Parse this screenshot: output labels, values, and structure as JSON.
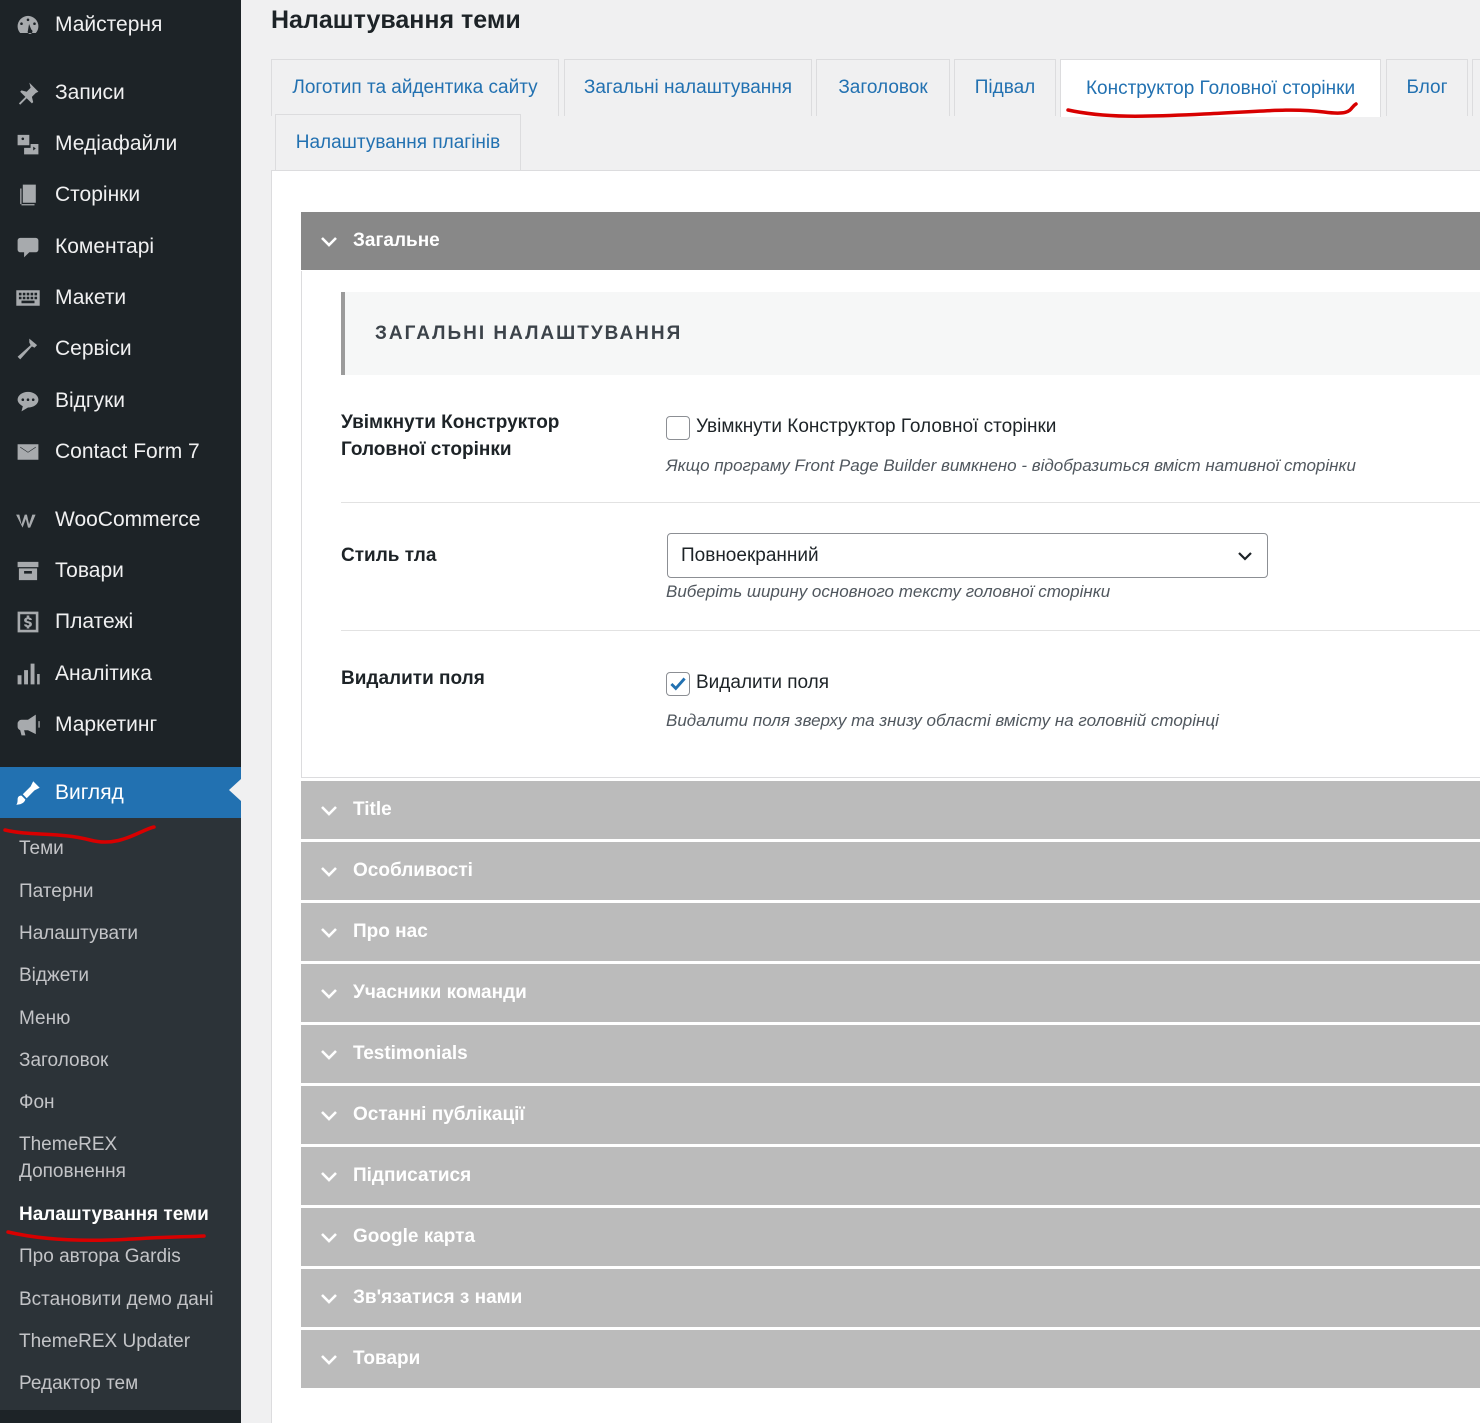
{
  "sidebar": {
    "items": [
      {
        "label": "Майстерня",
        "icon": "dashboard-icon"
      },
      {
        "label": "Записи",
        "icon": "pin-icon"
      },
      {
        "label": "Медіафайли",
        "icon": "media-icon"
      },
      {
        "label": "Сторінки",
        "icon": "pages-icon"
      },
      {
        "label": "Коментарі",
        "icon": "comment-icon"
      },
      {
        "label": "Макети",
        "icon": "layouts-icon"
      },
      {
        "label": "Сервіси",
        "icon": "hammer-icon"
      },
      {
        "label": "Відгуки",
        "icon": "feedback-icon"
      },
      {
        "label": "Contact Form 7",
        "icon": "mail-icon"
      },
      {
        "label": "WooCommerce",
        "icon": "woo-icon"
      },
      {
        "label": "Товари",
        "icon": "archive-icon"
      },
      {
        "label": "Платежі",
        "icon": "dollar-icon"
      },
      {
        "label": "Аналітика",
        "icon": "chart-icon"
      },
      {
        "label": "Маркетинг",
        "icon": "megaphone-icon"
      },
      {
        "label": "Вигляд",
        "icon": "brush-icon"
      }
    ],
    "submenu": [
      "Теми",
      "Патерни",
      "Налаштувати",
      "Віджети",
      "Меню",
      "Заголовок",
      "Фон",
      "ThemeREX Доповнення",
      "Налаштування теми",
      "Про автора Gardis",
      "Встановити демо дані",
      "ThemeREX Updater",
      "Редактор тем"
    ],
    "active_color": "#2271b1"
  },
  "page": {
    "title": "Налаштування теми"
  },
  "tabs": [
    "Логотип та айдентика сайту",
    "Загальні налаштування",
    "Заголовок",
    "Підвал",
    "Конструктор Головної сторінки",
    "Блог",
    "Налаштування плагінів"
  ],
  "active_tab": "Конструктор Головної сторінки",
  "accordion": {
    "open_section": "Загальне",
    "section_title": "ЗАГАЛЬНІ НАЛАШТУВАННЯ",
    "rows": {
      "enable_builder": {
        "label": "Увімкнути Конструктор Головної сторінки",
        "checkbox_label": "Увімкнути Конструктор Головної сторінки",
        "checked": false,
        "description": "Якщо програму Front Page Builder вимкнено - відобразиться вміст нативної сторінки"
      },
      "background_style": {
        "label": "Стиль тла",
        "selected": "Повноекранний",
        "description": "Виберіть ширину основного тексту головної сторінки"
      },
      "remove_margins": {
        "label": "Видалити поля",
        "checkbox_label": "Видалити поля",
        "checked": true,
        "description": "Видалити поля зверху та знизу області вмісту на головній сторінці"
      }
    },
    "collapsed_sections": [
      "Title",
      "Особливості",
      "Про нас",
      "Учасники команди",
      "Testimonials",
      "Останні публікації",
      "Підписатися",
      "Google карта",
      "Зв'язатися з нами",
      "Товари"
    ]
  },
  "colors": {
    "open_header": "#888888",
    "collapsed_header": "#bbbbbb",
    "annotation_red": "#d80000",
    "link_blue": "#2271b1"
  }
}
